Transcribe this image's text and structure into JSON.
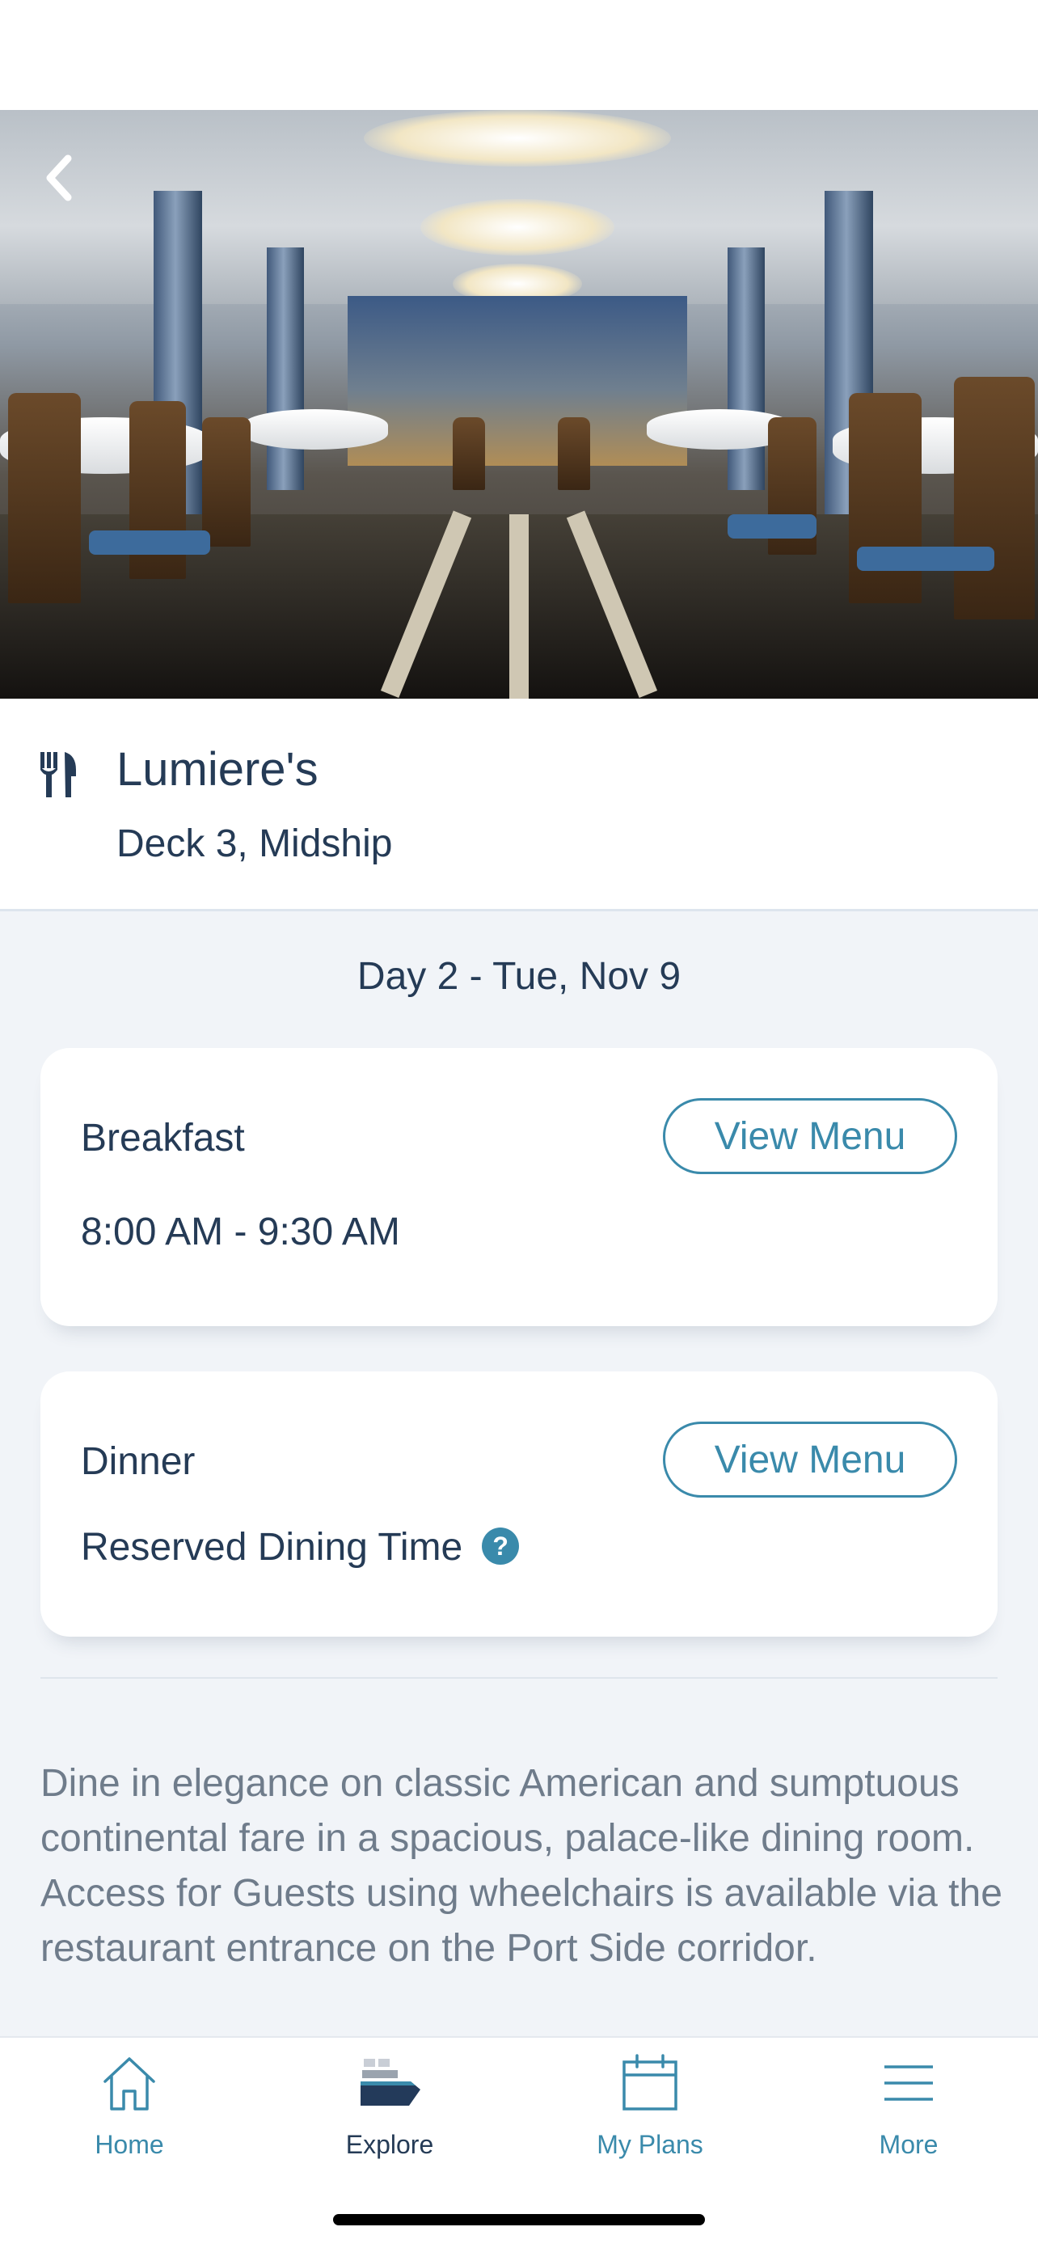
{
  "venue": {
    "name": "Lumiere's",
    "location": "Deck 3, Midship"
  },
  "day_label": "Day 2 - Tue, Nov 9",
  "meals": [
    {
      "title": "Breakfast",
      "detail": "8:00 AM - 9:30 AM",
      "button_label": "View Menu"
    },
    {
      "title": "Dinner",
      "detail": "Reserved Dining Time",
      "button_label": "View Menu",
      "help_icon": "question-icon"
    }
  ],
  "description": "Dine in elegance on classic American and sumptuous continental fare in a spacious, palace-like dining room. Access for Guests using wheelchairs is available via the restaurant entrance on the Port Side corridor.",
  "tabs": [
    {
      "label": "Home",
      "icon": "home-icon",
      "active": false
    },
    {
      "label": "Explore",
      "icon": "ship-icon",
      "active": true
    },
    {
      "label": "My Plans",
      "icon": "calendar-icon",
      "active": false
    },
    {
      "label": "More",
      "icon": "menu-icon",
      "active": false
    }
  ],
  "colors": {
    "accent": "#3a8aab",
    "text": "#253b56",
    "muted_text": "#6f7c8b",
    "background": "#f1f4f8"
  }
}
